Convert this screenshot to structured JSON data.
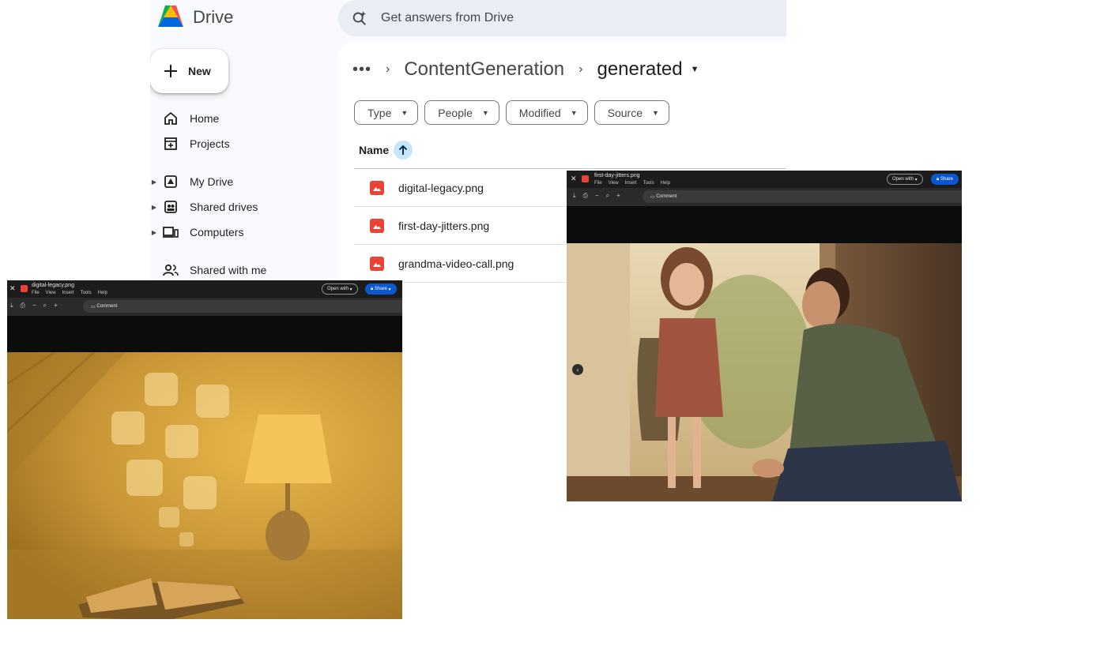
{
  "app": {
    "name": "Drive"
  },
  "search": {
    "placeholder": "Get answers from Drive"
  },
  "new_button": {
    "label": "New"
  },
  "sidebar": {
    "items": [
      {
        "label": "Home",
        "icon": "home-icon"
      },
      {
        "label": "Projects",
        "icon": "projects-icon"
      },
      {
        "label": "My Drive",
        "icon": "my-drive-icon"
      },
      {
        "label": "Shared drives",
        "icon": "shared-drives-icon"
      },
      {
        "label": "Computers",
        "icon": "computers-icon"
      },
      {
        "label": "Shared with me",
        "icon": "shared-with-me-icon"
      }
    ]
  },
  "breadcrumb": {
    "overflow": "•••",
    "parent": "ContentGeneration",
    "current": "generated"
  },
  "filters": [
    "Type",
    "People",
    "Modified",
    "Source"
  ],
  "table": {
    "name_header": "Name",
    "rows": [
      "digital-legacy.png",
      "first-day-jitters.png",
      "grandma-video-call.png"
    ]
  },
  "preview_left": {
    "title": "digital-legacy.png",
    "menu": [
      "File",
      "View",
      "Insert",
      "Tools",
      "Help"
    ],
    "open_with": "Open with",
    "share": "Share",
    "comment": "Comment"
  },
  "preview_right": {
    "title": "first-day-jitters.png",
    "menu": [
      "File",
      "View",
      "Insert",
      "Tools",
      "Help"
    ],
    "open_with": "Open with",
    "share": "Share",
    "comment": "Comment"
  },
  "colors": {
    "accent": "#0b57d0",
    "sort_bg": "#c2e7ff",
    "image_icon": "#ea4335",
    "surface": "#f8fafd"
  }
}
